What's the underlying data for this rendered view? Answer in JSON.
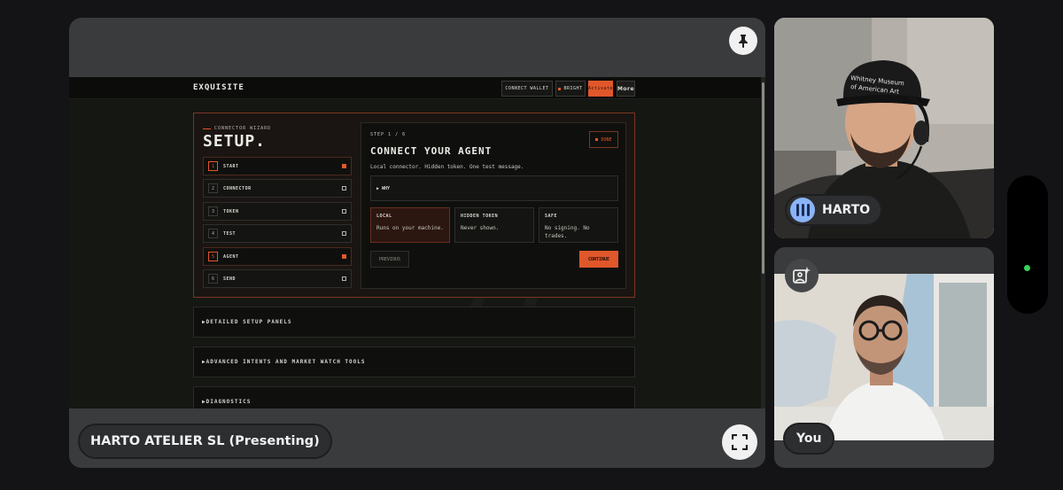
{
  "presentation": {
    "presenter_label": "HARTO ATELIER SL (Presenting)",
    "shared_app": {
      "logo": "EXQUISITE",
      "header_buttons": {
        "connect_wallet": "CONNECT WALLET",
        "bright": "BRIGHT",
        "active": "Activate",
        "more": "More"
      },
      "wizard": {
        "eyebrow": "CONNECTOR WIZARD",
        "title": "SETUP.",
        "steps": [
          {
            "num": "1",
            "label": "START",
            "active": true
          },
          {
            "num": "2",
            "label": "CONNECTOR",
            "active": false
          },
          {
            "num": "3",
            "label": "TOKEN",
            "active": false
          },
          {
            "num": "4",
            "label": "TEST",
            "active": false
          },
          {
            "num": "5",
            "label": "AGENT",
            "active": true
          },
          {
            "num": "6",
            "label": "SEND",
            "active": false
          }
        ],
        "card": {
          "step_indicator": "STEP 1 / 6",
          "title": "CONNECT YOUR AGENT",
          "done_label": "DONE",
          "description": "Local connector. Hidden token. One test message.",
          "why_label": "▶ WHY",
          "features": [
            {
              "title": "LOCAL",
              "desc": "Runs on your machine."
            },
            {
              "title": "HIDDEN TOKEN",
              "desc": "Never shown."
            },
            {
              "title": "SAFE",
              "desc": "No signing. No trades."
            }
          ],
          "previous_label": "PREVIOUS",
          "continue_label": "CONTINUE"
        }
      },
      "watermark": "77",
      "accordions": [
        "▶DETAILED SETUP PANELS",
        "▶ADVANCED INTENTS AND MARKET WATCH TOOLS",
        "▶DIAGNOSTICS"
      ]
    }
  },
  "participants": {
    "harto": {
      "name": "HARTO"
    },
    "you": {
      "name": "You"
    }
  },
  "colors": {
    "accent": "#e0572b",
    "speaking": "#8ab4f8",
    "status_dot": "#35d35a"
  }
}
